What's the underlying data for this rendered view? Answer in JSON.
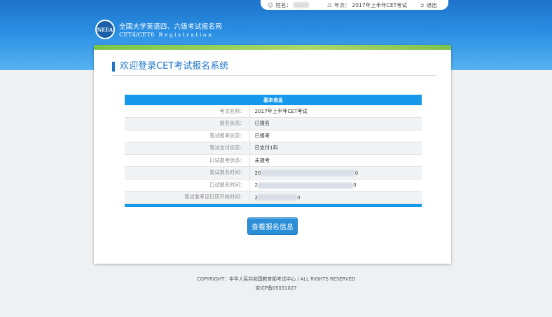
{
  "topbar": {
    "name_label": "姓名：",
    "session_label": "年次：",
    "session_value": "2017年上半年CET考试",
    "logout_label": "退出"
  },
  "logo": {
    "emblem_text": "NEEA",
    "title_cn": "全国大学英语四、六级考试报名网",
    "title_en": "CET4/CET6",
    "subtitle_en": "Registration"
  },
  "card": {
    "title": "欢迎登录CET考试报名系统"
  },
  "info_table": {
    "header": "基本信息",
    "rows": [
      {
        "label": "考次名称：",
        "value": "2017年上半年CET考试"
      },
      {
        "label": "报名状态：",
        "value": "已报名"
      },
      {
        "label": "笔试报考状态：",
        "value": "已报考"
      },
      {
        "label": "笔试支付状态：",
        "value": "已支付1科"
      },
      {
        "label": "口试报考状态：",
        "value": "未报考"
      },
      {
        "label": "笔试报名时间：",
        "value_start": "20",
        "value_end": "0"
      },
      {
        "label": "口试报名时间：",
        "value_start": "2",
        "value_end": "0"
      },
      {
        "label": "笔试准考证打印开始时间：",
        "value_start": "2",
        "value_end": "0"
      }
    ]
  },
  "button": {
    "view_label": "查看报名信息"
  },
  "footer": {
    "copyright": "COPYRIGHT：中华人民共和国教育部考试中心 / ALL RIGHTS RESERVED",
    "icp": "京ICP备05031027"
  },
  "colors": {
    "brand_blue": "#1e74c8",
    "table_header": "#1699ea",
    "button": "#2b8fd8",
    "accent_green": "#79c64a"
  },
  "icons": {
    "user": "user-icon",
    "session": "session-icon",
    "logout": "logout-icon"
  }
}
